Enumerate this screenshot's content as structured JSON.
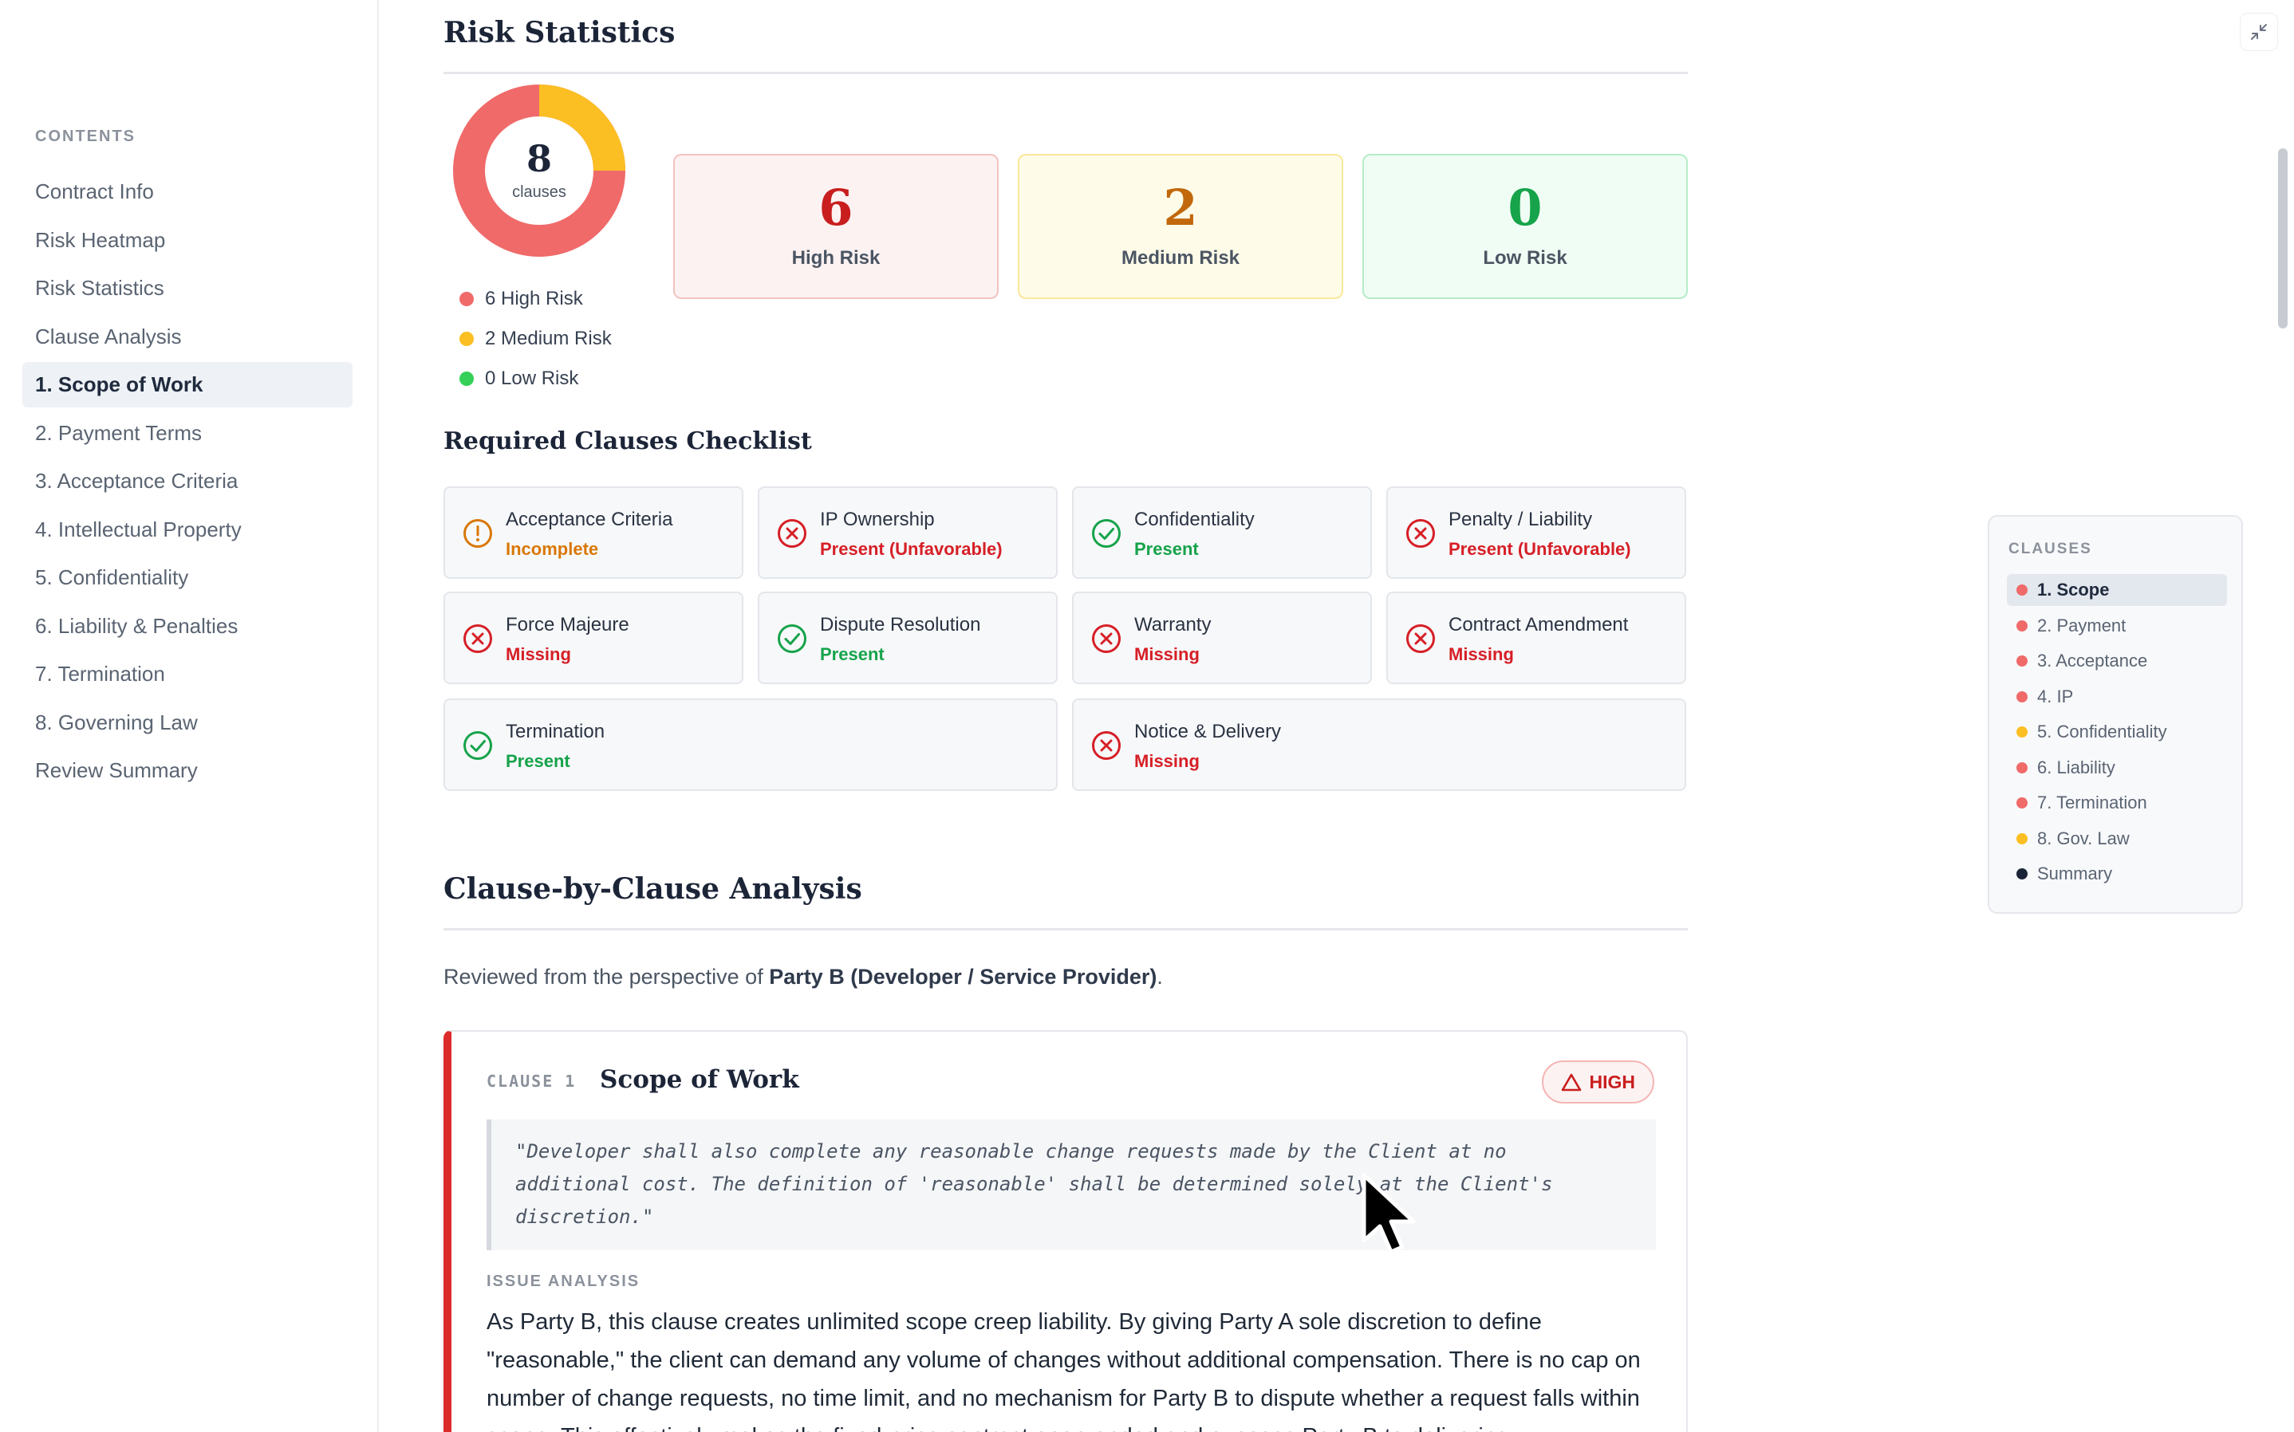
{
  "sidebar": {
    "heading": "CONTENTS",
    "items": [
      {
        "label": "Contract Info"
      },
      {
        "label": "Risk Heatmap"
      },
      {
        "label": "Risk Statistics"
      },
      {
        "label": "Clause Analysis"
      },
      {
        "label": "1. Scope of Work",
        "active": true
      },
      {
        "label": "2. Payment Terms"
      },
      {
        "label": "3. Acceptance Criteria"
      },
      {
        "label": "4. Intellectual Property"
      },
      {
        "label": "5. Confidentiality"
      },
      {
        "label": "6. Liability & Penalties"
      },
      {
        "label": "7. Termination"
      },
      {
        "label": "8. Governing Law"
      },
      {
        "label": "Review Summary"
      }
    ]
  },
  "risk_stats": {
    "title": "Risk Statistics",
    "total": "8",
    "total_caption": "clauses",
    "donut": {
      "high": 6,
      "medium": 2,
      "low": 0
    },
    "legend": [
      "6 High Risk",
      "2 Medium Risk",
      "0 Low Risk"
    ],
    "cards": [
      {
        "value": "6",
        "label": "High Risk"
      },
      {
        "value": "2",
        "label": "Medium Risk"
      },
      {
        "value": "0",
        "label": "Low Risk"
      }
    ],
    "colors": {
      "high": "#f06a6a",
      "medium": "#fbbf24",
      "low": "#34d058",
      "high_text": "#c81e1e",
      "medium_text": "#c2680c",
      "low_text": "#16a34a"
    }
  },
  "checklist": {
    "title": "Required Clauses Checklist",
    "items": [
      {
        "name": "Acceptance Criteria",
        "status": "Incomplete",
        "kind": "warn"
      },
      {
        "name": "IP Ownership",
        "status": "Present (Unfavorable)",
        "kind": "bad"
      },
      {
        "name": "Confidentiality",
        "status": "Present",
        "kind": "ok"
      },
      {
        "name": "Penalty / Liability",
        "status": "Present (Unfavorable)",
        "kind": "bad"
      },
      {
        "name": "Force Majeure",
        "status": "Missing",
        "kind": "bad"
      },
      {
        "name": "Dispute Resolution",
        "status": "Present",
        "kind": "ok"
      },
      {
        "name": "Warranty",
        "status": "Missing",
        "kind": "bad"
      },
      {
        "name": "Contract Amendment",
        "status": "Missing",
        "kind": "bad"
      },
      {
        "name": "Termination",
        "status": "Present",
        "kind": "ok"
      },
      {
        "name": "Notice & Delivery",
        "status": "Missing",
        "kind": "bad"
      }
    ]
  },
  "analysis": {
    "title": "Clause-by-Clause Analysis",
    "perspective_prefix": "Reviewed from the perspective of ",
    "perspective_party": "Party B (Developer / Service Provider)",
    "perspective_suffix": ".",
    "clause": {
      "tag": "CLAUSE 1",
      "title": "Scope of Work",
      "risk": "HIGH",
      "quote": "\"Developer shall also complete any reasonable change requests made by the Client at no additional cost. The definition of 'reasonable' shall be determined solely at the Client's discretion.\"",
      "issue_label": "ISSUE ANALYSIS",
      "issue_text": "As Party B, this clause creates unlimited scope creep liability. By giving Party A sole discretion to define \"reasonable,\" the client can demand any volume of changes without additional compensation. There is no cap on number of change requests, no time limit, and no mechanism for Party B to dispute whether a request falls within scope. This effectively makes the fixed-price contract open-ended and exposes Party B to delivering"
    }
  },
  "mini_toc": {
    "heading": "CLAUSES",
    "items": [
      {
        "label": "1. Scope",
        "risk": "high",
        "active": true
      },
      {
        "label": "2. Payment",
        "risk": "high"
      },
      {
        "label": "3. Acceptance",
        "risk": "high"
      },
      {
        "label": "4. IP",
        "risk": "high"
      },
      {
        "label": "5. Confidentiality",
        "risk": "medium"
      },
      {
        "label": "6. Liability",
        "risk": "high"
      },
      {
        "label": "7. Termination",
        "risk": "high"
      },
      {
        "label": "8. Gov. Law",
        "risk": "medium"
      },
      {
        "label": "Summary",
        "risk": "summary"
      }
    ]
  },
  "icons": {
    "collapse": "collapse-icon",
    "ok": "check-circle-icon",
    "bad": "x-circle-icon",
    "warn": "alert-circle-icon",
    "risk": "warning-triangle-icon"
  }
}
